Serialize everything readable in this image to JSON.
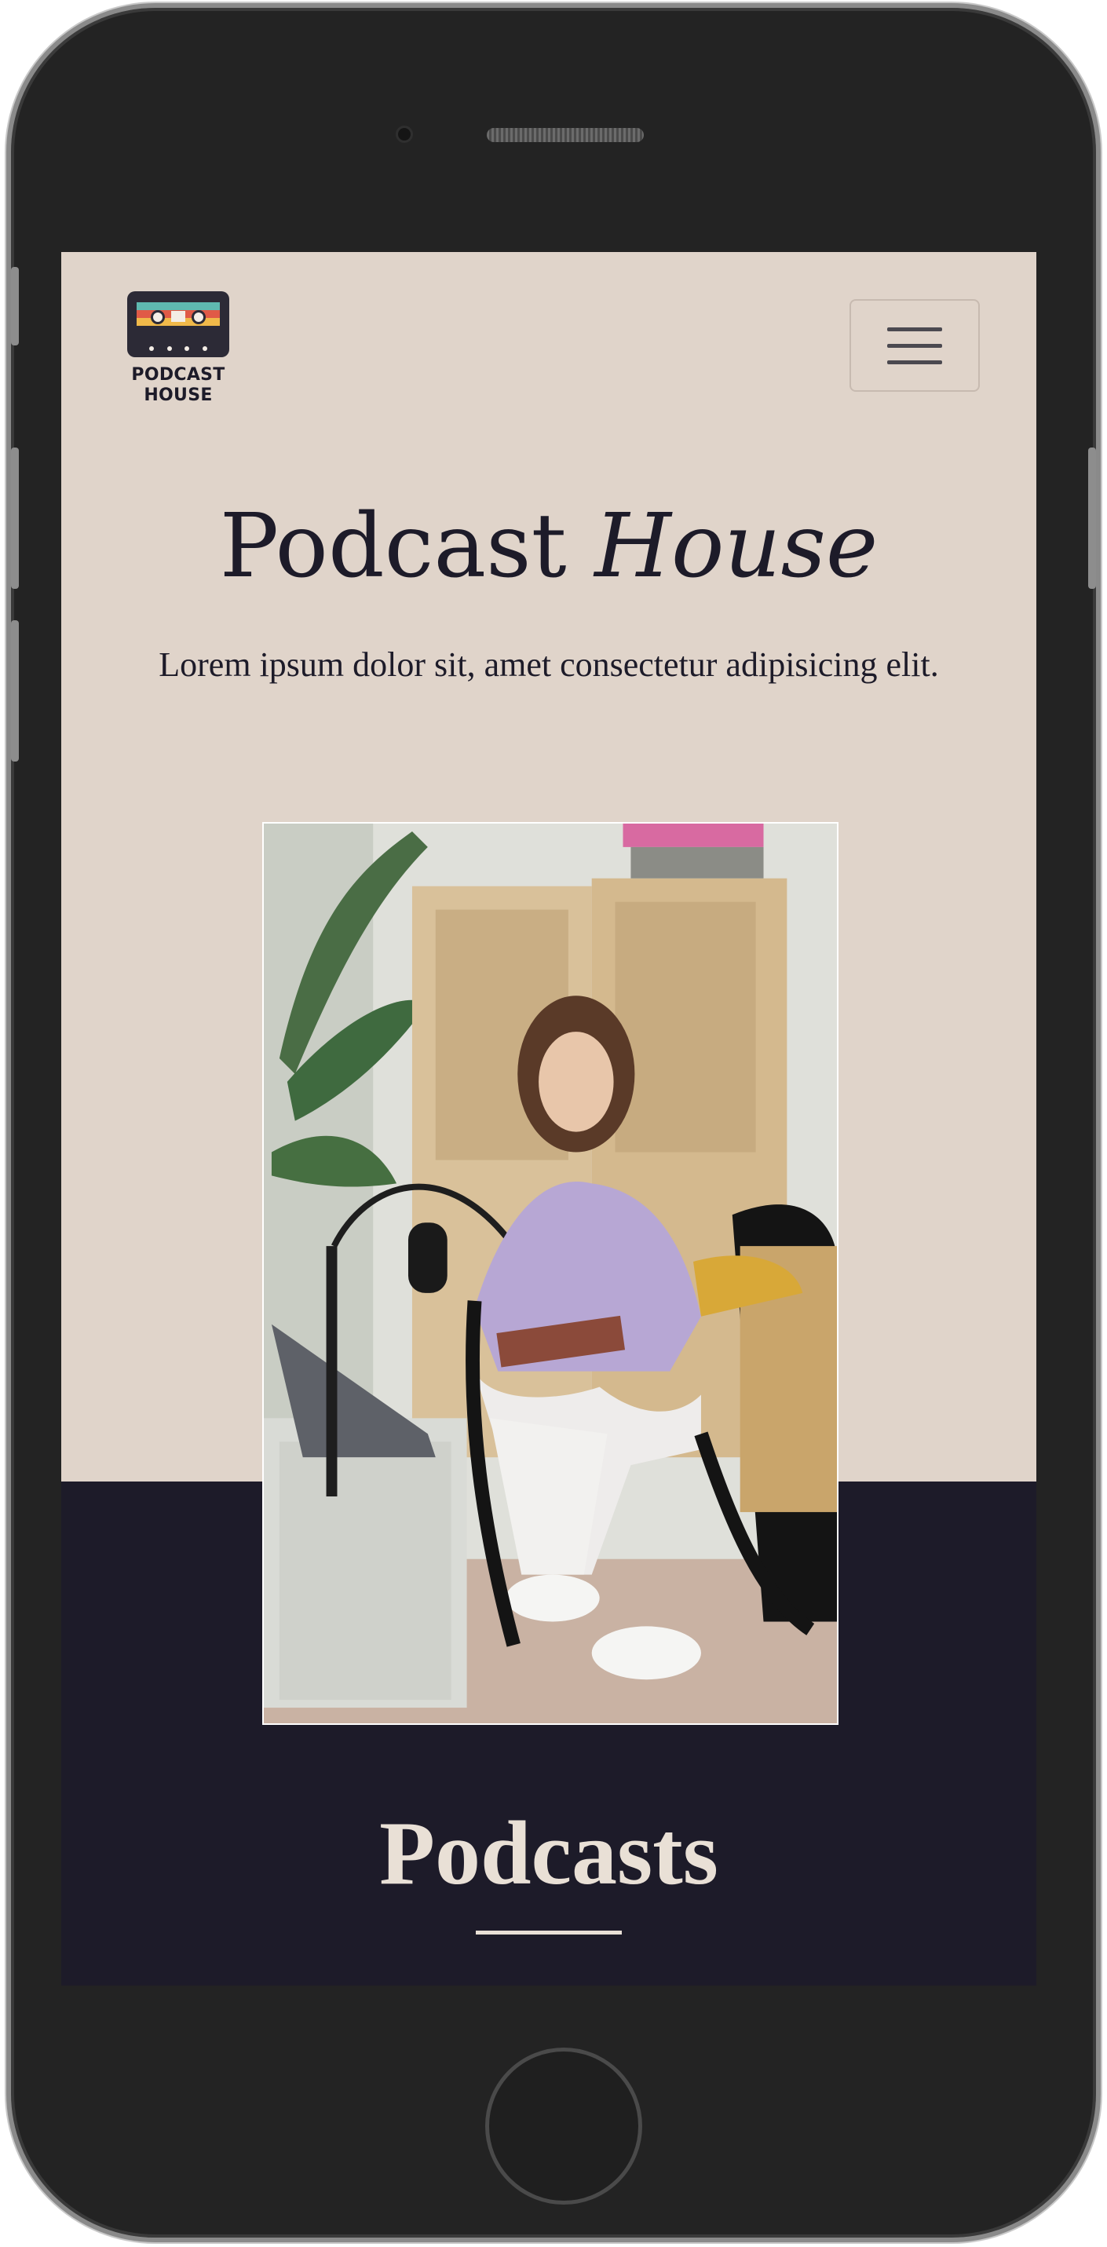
{
  "header": {
    "logo_text": "PODCAST\nHOUSE",
    "menu_icon": "hamburger-icon"
  },
  "hero": {
    "title_regular": "Podcast",
    "title_italic": "House",
    "subtitle": "Lorem ipsum dolor sit, amet consectetur adipisicing elit.",
    "image_description_icon": "photo"
  },
  "section": {
    "title": "Podcasts"
  },
  "colors": {
    "beige": "#e0d4ca",
    "navy": "#1d1b29",
    "cream": "#e9e0d6"
  }
}
